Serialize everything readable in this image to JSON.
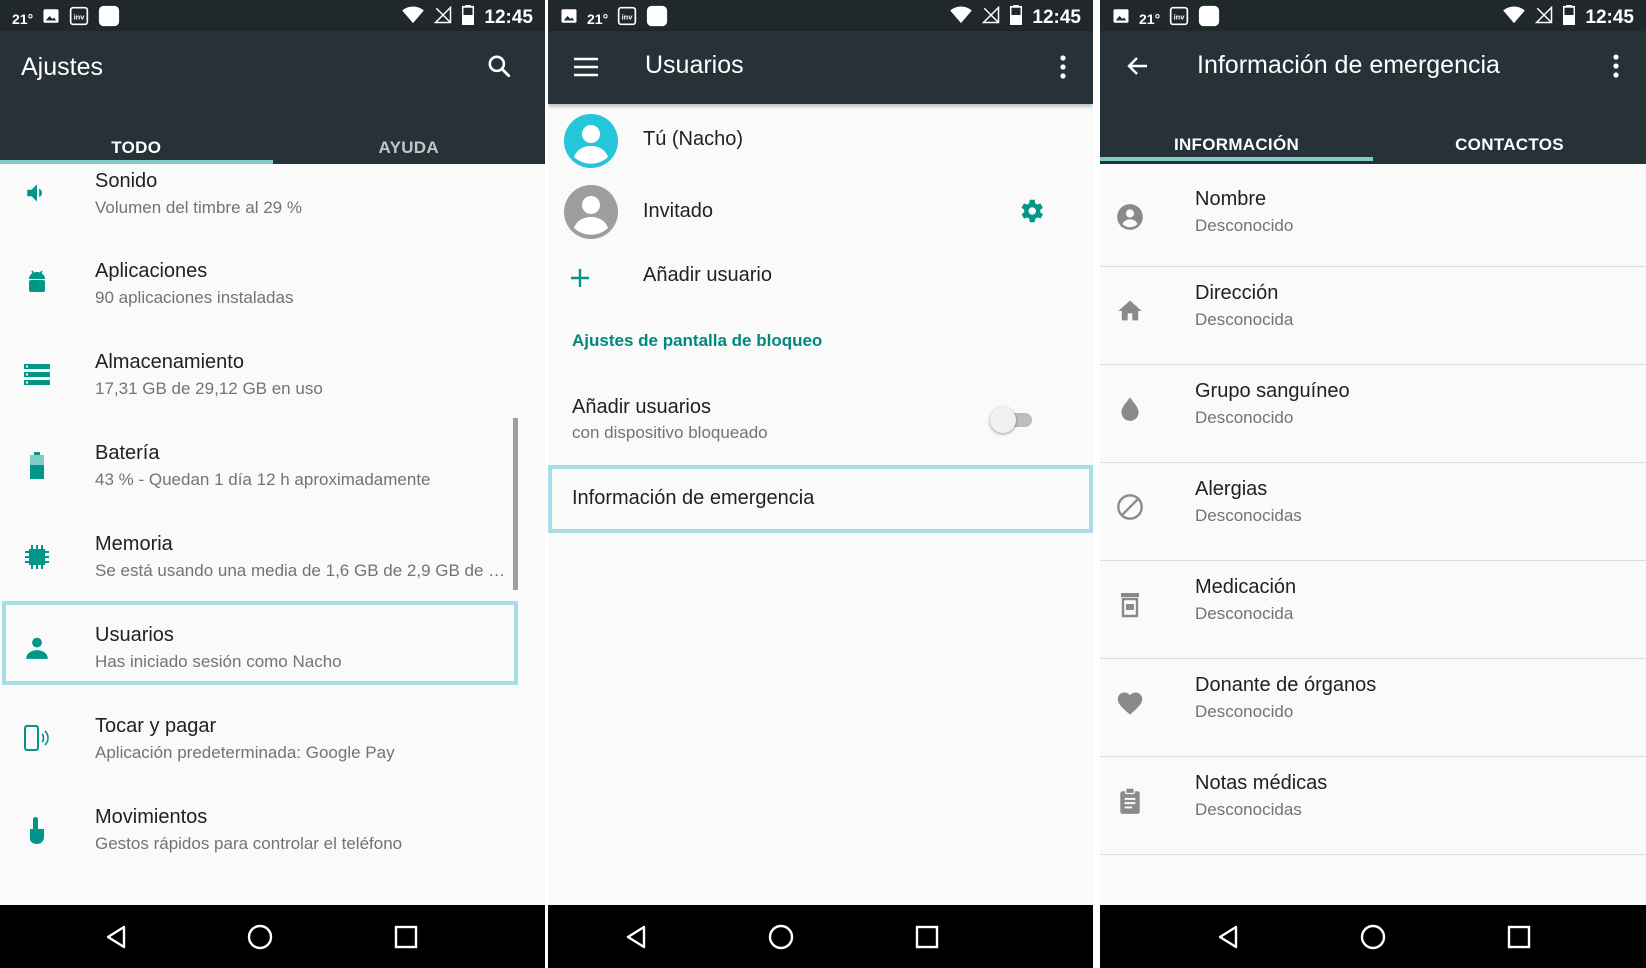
{
  "status": {
    "temp": "21°",
    "time": "12:45"
  },
  "screen1": {
    "title": "Ajustes",
    "tabs": [
      {
        "label": "TODO"
      },
      {
        "label": "AYUDA"
      }
    ],
    "items": [
      {
        "title": "Sonido",
        "subtitle": "Volumen del timbre al 29 %",
        "icon": "volume-icon"
      },
      {
        "title": "Aplicaciones",
        "subtitle": "90 aplicaciones instaladas",
        "icon": "android-icon"
      },
      {
        "title": "Almacenamiento",
        "subtitle": "17,31 GB de 29,12 GB en uso",
        "icon": "storage-icon"
      },
      {
        "title": "Batería",
        "subtitle": "43 % - Quedan 1 día 12 h aproximadamente",
        "icon": "battery-icon"
      },
      {
        "title": "Memoria",
        "subtitle": "Se está usando una media de 1,6 GB de 2,9 GB de …",
        "icon": "memory-icon"
      },
      {
        "title": "Usuarios",
        "subtitle": "Has iniciado sesión como Nacho",
        "icon": "person-icon"
      },
      {
        "title": "Tocar y pagar",
        "subtitle": "Aplicación predeterminada: Google Pay",
        "icon": "tap-pay-icon"
      },
      {
        "title": "Movimientos",
        "subtitle": "Gestos rápidos para controlar el teléfono",
        "icon": "gesture-icon"
      }
    ]
  },
  "screen2": {
    "title": "Usuarios",
    "users": [
      {
        "name": "Tú (Nacho)"
      },
      {
        "name": "Invitado"
      }
    ],
    "add_user": "Añadir usuario",
    "section_header": "Ajustes de pantalla de bloqueo",
    "toggle_title": "Añadir usuarios",
    "toggle_subtitle": "con dispositivo bloqueado",
    "emergency": "Información de emergencia"
  },
  "screen3": {
    "title": "Información de emergencia",
    "tabs": [
      {
        "label": "INFORMACIÓN"
      },
      {
        "label": "CONTACTOS"
      }
    ],
    "items": [
      {
        "title": "Nombre",
        "subtitle": "Desconocido",
        "icon": "account-circle-icon"
      },
      {
        "title": "Dirección",
        "subtitle": "Desconocida",
        "icon": "home-icon"
      },
      {
        "title": "Grupo sanguíneo",
        "subtitle": "Desconocido",
        "icon": "drop-icon"
      },
      {
        "title": "Alergias",
        "subtitle": "Desconocidas",
        "icon": "block-icon"
      },
      {
        "title": "Medicación",
        "subtitle": "Desconocida",
        "icon": "pill-bottle-icon"
      },
      {
        "title": "Donante de órganos",
        "subtitle": "Desconocido",
        "icon": "heart-icon"
      },
      {
        "title": "Notas médicas",
        "subtitle": "Desconocidas",
        "icon": "clipboard-icon"
      }
    ]
  },
  "colors": {
    "appbar": "#263238",
    "statusbar": "#20282c",
    "accent": "#009688",
    "highlight": "#a5dde8"
  }
}
